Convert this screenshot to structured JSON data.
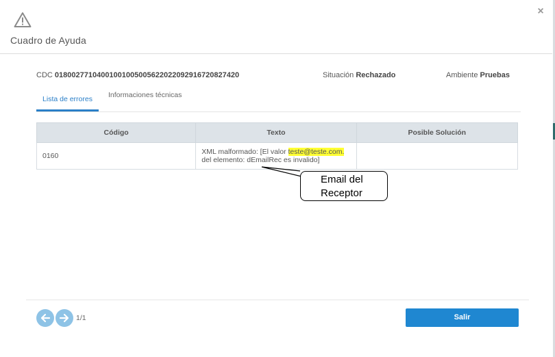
{
  "header": {
    "title": "Cuadro de Ayuda",
    "close_label": "×",
    "icon": "warning-triangle-icon"
  },
  "info": {
    "cdc_label": "CDC",
    "cdc_value": "01800277104001001005005622022092916720827420",
    "situacion_label": "Situación",
    "situacion_value": "Rechazado",
    "ambiente_label": "Ambiente",
    "ambiente_value": "Pruebas"
  },
  "tabs": [
    {
      "label": "Lista de errores",
      "active": true
    },
    {
      "label": "Informaciones técnicas",
      "active": false
    }
  ],
  "table": {
    "headers": [
      "Código",
      "Texto",
      "Posible Solución"
    ],
    "rows": [
      {
        "codigo": "0160",
        "texto_before": "XML malformado: [El valor ",
        "texto_highlight": "teste@teste.com.",
        "texto_after": "del elemento: dEmailRec es invalido]",
        "solucion": ""
      }
    ]
  },
  "annotation": {
    "line1": "Email del",
    "line2": "Receptor"
  },
  "footer": {
    "prev_icon": "arrow-left-icon",
    "next_icon": "arrow-right-icon",
    "page_indicator": "1/1",
    "exit_label": "Salir"
  },
  "colors": {
    "accent": "#1f87d1",
    "nav_button": "#8ec3e6",
    "highlight": "#ffff33",
    "table_header_bg": "#dde3e8"
  }
}
